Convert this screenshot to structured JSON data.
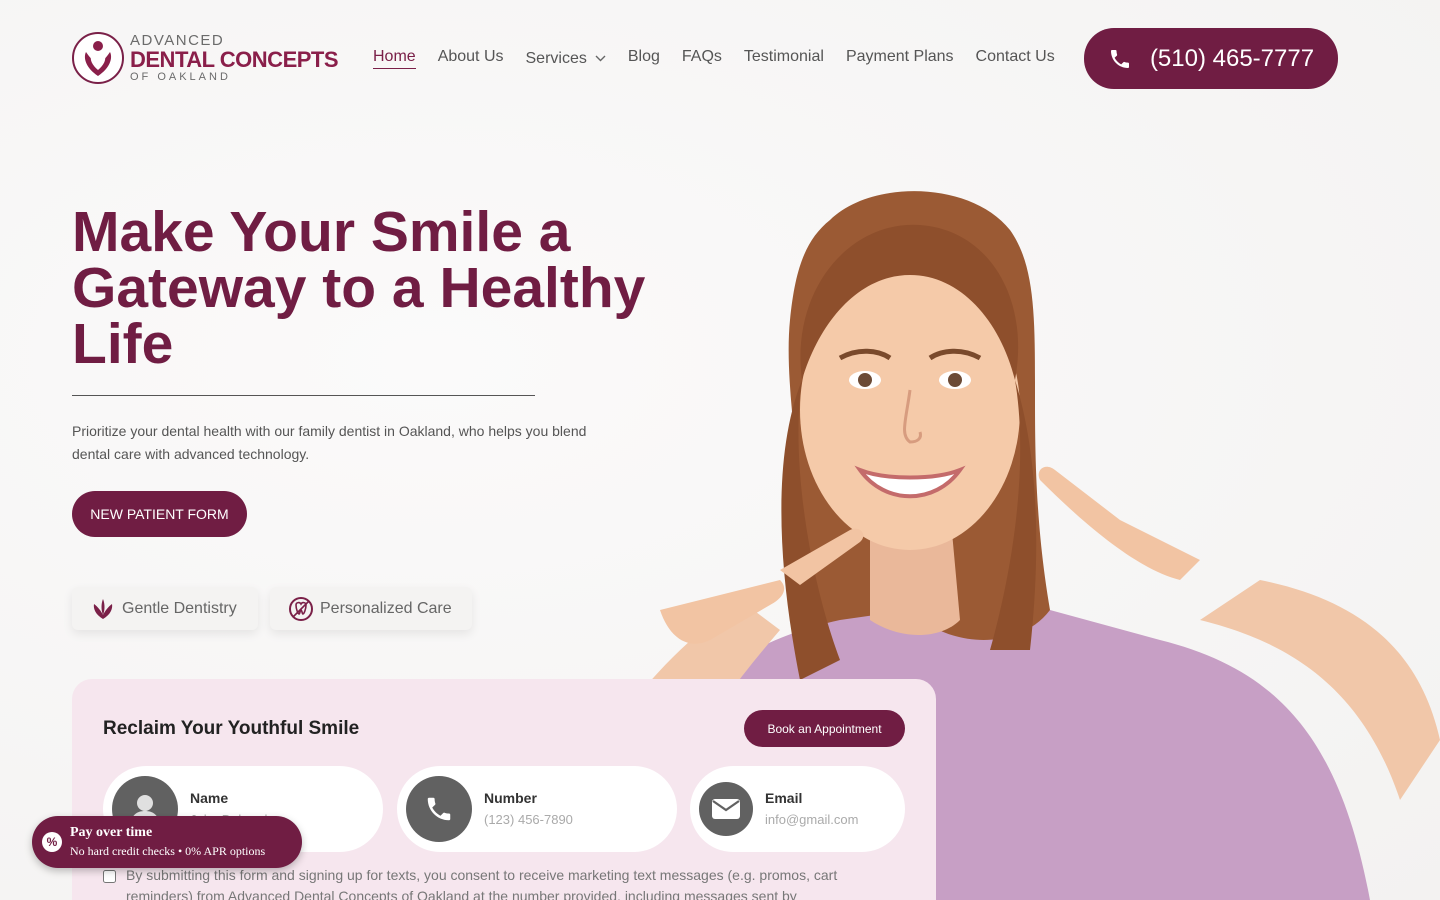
{
  "brand": {
    "line1": "ADVANCED",
    "line2": "DENTAL CONCEPTS",
    "line3": "OF OAKLAND",
    "color": "#701d43"
  },
  "nav": {
    "items": [
      "Home",
      "About Us",
      "Services",
      "Blog",
      "FAQs",
      "Testimonial",
      "Payment Plans",
      "Contact Us"
    ]
  },
  "phone": {
    "label": "(510) 465-7777",
    "icon": "phone-icon"
  },
  "hero": {
    "title": "Make Your Smile a Gateway to a Healthy Life",
    "description": "Prioritize your dental health with our family dentist in Oakland, who helps you blend dental care with advanced technology.",
    "cta": "NEW PATIENT FORM",
    "features": [
      {
        "label": "Gentle Dentistry",
        "icon": "lotus-icon"
      },
      {
        "label": "Personalized Care",
        "icon": "tooth-cross-icon"
      }
    ]
  },
  "form": {
    "title": "Reclaim Your Youthful Smile",
    "book_label": "Book an Appointment",
    "fields": {
      "name": {
        "label": "Name",
        "placeholder": "John Deborah",
        "icon": "user-icon"
      },
      "number": {
        "label": "Number",
        "placeholder": "(123) 456-7890",
        "icon": "phone-icon"
      },
      "email": {
        "label": "Email",
        "placeholder": "info@gmail.com",
        "icon": "envelope-icon"
      }
    },
    "consent": "By submitting this form and signing up for texts, you consent to receive marketing text messages (e.g. promos, cart reminders) from Advanced Dental Concepts of Oakland at the number provided, including messages sent by"
  },
  "pay_badge": {
    "title": "Pay over time",
    "subtitle": "No hard credit checks • 0% APR options",
    "icon": "percent-icon"
  }
}
